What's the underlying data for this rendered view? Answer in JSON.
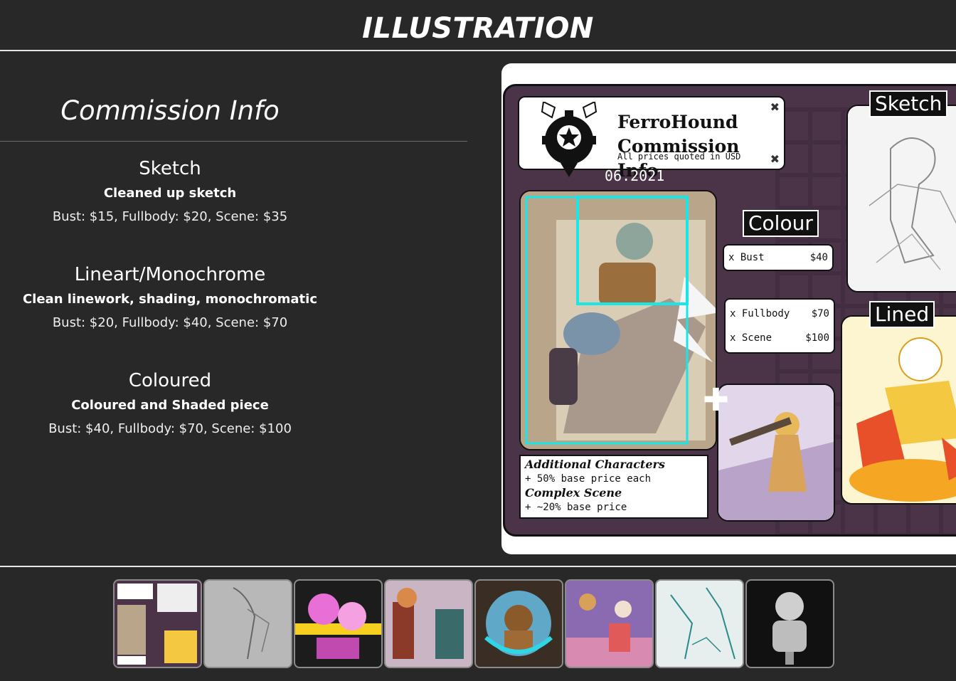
{
  "header": {
    "title": "ILLUSTRATION"
  },
  "commission": {
    "title": "Commission Info",
    "tiers": [
      {
        "name": "Sketch",
        "description": "Cleaned up sketch",
        "prices": "Bust: $15, Fullbody: $20, Scene: $35"
      },
      {
        "name": "Lineart/Monochrome",
        "description": "Clean linework, shading, monochromatic",
        "prices": "Bust: $20, Fullbody: $40, Scene: $70"
      },
      {
        "name": "Coloured",
        "description": "Coloured and Shaded piece",
        "prices": "Bust: $40, Fullbody: $70, Scene: $100"
      }
    ]
  },
  "sheet": {
    "name_line1": "FerroHound",
    "name_line2": "Commission Info",
    "subtitle": "All prices quoted in USD",
    "date": "06.2021",
    "label_colour": "Colour",
    "label_sketch": "Sketch",
    "label_lined": "Lined",
    "bust_label": "x Bust",
    "bust_price": "$40",
    "fullbody_label": "x Fullbody",
    "fullbody_price": "$70",
    "scene_label": "x Scene",
    "scene_price": "$100",
    "addl_head": "Additional Characters",
    "addl_line": "+ 50% base price each",
    "complex_head": "Complex Scene",
    "complex_line": "+ ~20% base price"
  },
  "gallery": {
    "thumbnails": [
      "commission-sheet",
      "sketch",
      "warning-art",
      "characters",
      "badge-art",
      "group-scene",
      "teal-lineart",
      "monochrome"
    ]
  },
  "colors": {
    "background": "#282828",
    "text": "#ffffff",
    "accent_cyan": "#19e6e6",
    "sheet_purple": "#4b3448"
  }
}
